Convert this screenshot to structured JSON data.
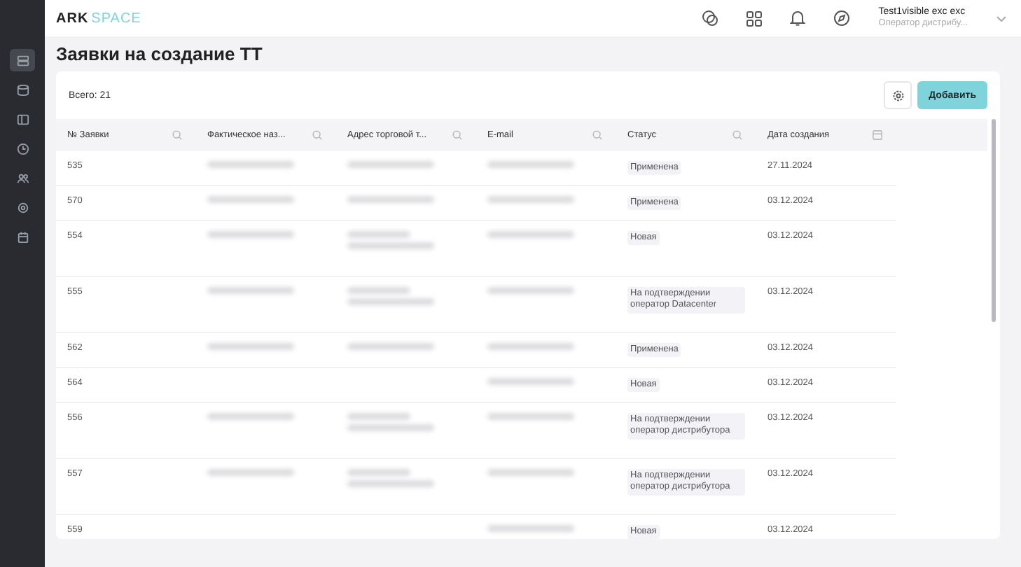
{
  "sidebar": {
    "items": [
      {
        "selected": true
      },
      {
        "selected": false
      },
      {
        "selected": false
      },
      {
        "selected": false
      },
      {
        "selected": false
      },
      {
        "selected": false
      },
      {
        "selected": false
      }
    ]
  },
  "header": {
    "logo_left": "ARK",
    "logo_right": "SPACE",
    "user_name": "Test1visible exc exc",
    "user_role": "Оператор дистрибу..."
  },
  "page_title": "Заявки на создание ТТ",
  "total": "Всего: 21",
  "add_button": "Добавить",
  "table": {
    "columns": [
      "№ Заявки",
      "Фактическое наз...",
      "Адрес торговой т...",
      "E-mail",
      "Статус",
      "Дата создания"
    ],
    "rows": [
      {
        "kind": "single",
        "number": "535",
        "status": "Применена",
        "date": "27.11.2024"
      },
      {
        "kind": "single",
        "number": "570",
        "status": "Применена",
        "date": "03.12.2024"
      },
      {
        "kind": "double",
        "number": "554",
        "status": "Новая",
        "date": "03.12.2024"
      },
      {
        "kind": "double",
        "number": "555",
        "status": "На подтверждении оператор Datacenter",
        "date": "03.12.2024"
      },
      {
        "kind": "single",
        "number": "562",
        "status": "Применена",
        "date": "03.12.2024"
      },
      {
        "kind": "email_only",
        "number": "564",
        "status": "Новая",
        "date": "03.12.2024"
      },
      {
        "kind": "double",
        "number": "556",
        "status": "На подтверждении оператор дистрибутора",
        "date": "03.12.2024"
      },
      {
        "kind": "double",
        "number": "557",
        "status": "На подтверждении оператор дистрибутора",
        "date": "03.12.2024"
      },
      {
        "kind": "email_only",
        "number": "559",
        "status": "Новая",
        "date": "03.12.2024"
      }
    ]
  }
}
